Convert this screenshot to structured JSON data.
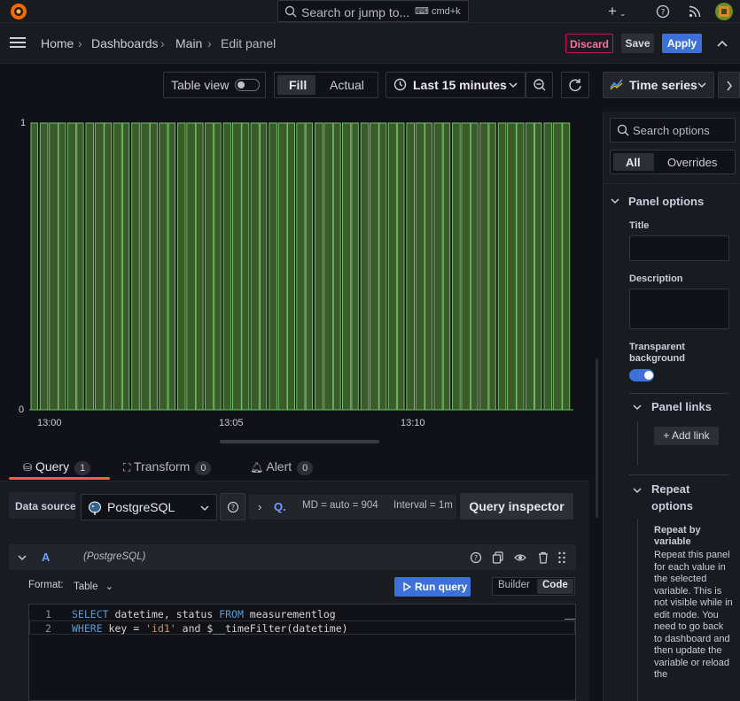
{
  "topbar": {
    "search_placeholder": "Search or jump to...",
    "shortcut": "cmd+k",
    "add_label": "+",
    "colors": {
      "logo": "#f46800"
    }
  },
  "breadcrumb": [
    "Home",
    "Dashboards",
    "Main",
    "Edit panel"
  ],
  "actions": {
    "discard": "Discard",
    "save": "Save",
    "apply": "Apply"
  },
  "toolbar": {
    "table_view": "Table view",
    "fill": "Fill",
    "actual": "Actual",
    "time_range": "Last 15 minutes",
    "visualization": "Time series"
  },
  "chart_data": {
    "type": "bar",
    "y_ticks": [
      "0",
      "1"
    ],
    "x_ticks": [
      "13:00",
      "13:05",
      "13:10"
    ],
    "ylim": [
      0,
      1
    ],
    "xlim": [
      0,
      15
    ],
    "x_tick_values": [
      0.5,
      5.5,
      10.5
    ],
    "bar_count": 59,
    "colors": {
      "fill": "#3b5b2a",
      "line": "#73bf69"
    }
  },
  "tabs": [
    {
      "label": "Query",
      "count": "1"
    },
    {
      "label": "Transform",
      "count": "0"
    },
    {
      "label": "Alert",
      "count": "0"
    }
  ],
  "query": {
    "datasource_label": "Data source",
    "datasource": "PostgreSQL",
    "md": "MD = auto = 904",
    "interval": "Interval = 1m",
    "inspector": "Query inspector",
    "letter": "A",
    "letter_ds": "(PostgreSQL)",
    "format_label": "Format:",
    "format_value": "Table",
    "run": "Run query",
    "builder": "Builder",
    "code": "Code",
    "line1": {
      "n": "1",
      "k1": "SELECT",
      "t1": " datetime, status ",
      "k2": "FROM",
      "t2": " measurementlog"
    },
    "line2": {
      "n": "2",
      "k1": "WHERE",
      "t1": " key = ",
      "s": "'id1'",
      "t2": " and $__timeFilter(datetime)"
    }
  },
  "options": {
    "search_placeholder": "Search options",
    "tab_all": "All",
    "tab_overrides": "Overrides",
    "panel_options": "Panel options",
    "title_label": "Title",
    "description_label": "Description",
    "transparent_label_1": "Transparent",
    "transparent_label_2": "background",
    "panel_links": "Panel links",
    "add_link": "+ Add link",
    "repeat_1": "Repeat",
    "repeat_2": "options",
    "repeat_by_1": "Repeat by",
    "repeat_by_2": "variable",
    "help": "Repeat this panel for each value in the selected variable. This is not visible while in edit mode. You need to go back to dashboard and then update the variable or reload the"
  }
}
